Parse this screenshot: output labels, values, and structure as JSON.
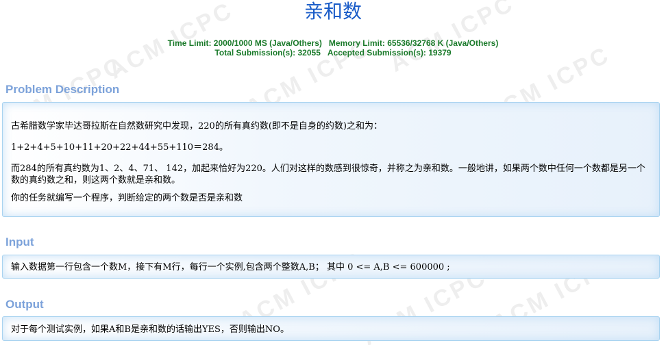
{
  "problem": {
    "title": "亲和数",
    "time_limit": "Time Limit: 2000/1000 MS (Java/Others)",
    "memory_limit": "Memory Limit: 65536/32768 K (Java/Others)",
    "total_submissions": "Total Submission(s): 32055",
    "accepted_submissions": "Accepted Submission(s): 19379"
  },
  "sections": {
    "description": {
      "heading": "Problem Description",
      "paragraphs": [
        "古希腊数学家毕达哥拉斯在自然数研究中发现，220的所有真约数(即不是自身的约数)之和为：",
        "1+2+4+5+10+11+20+22+44+55+110＝284。",
        "而284的所有真约数为1、2、4、71、 142，加起来恰好为220。人们对这样的数感到很惊奇，并称之为亲和数。一般地讲，如果两个数中任何一个数都是另一个数的真约数之和，则这两个数就是亲和数。",
        "你的任务就编写一个程序，判断给定的两个数是否是亲和数"
      ]
    },
    "input": {
      "heading": "Input",
      "text": "输入数据第一行包含一个数M，接下有M行，每行一个实例,包含两个整数A,B； 其中 0 <= A,B <= 600000 ;"
    },
    "output": {
      "heading": "Output",
      "text": "对于每个测试实例，如果A和B是亲和数的话输出YES，否则输出NO。"
    }
  },
  "watermark": {
    "text": "ACM ICPC"
  },
  "colors": {
    "title": "#1a5cc8",
    "limits": "#1a7a2a",
    "section_heading": "#7ca2da",
    "panel_border": "#a9d3f0"
  }
}
